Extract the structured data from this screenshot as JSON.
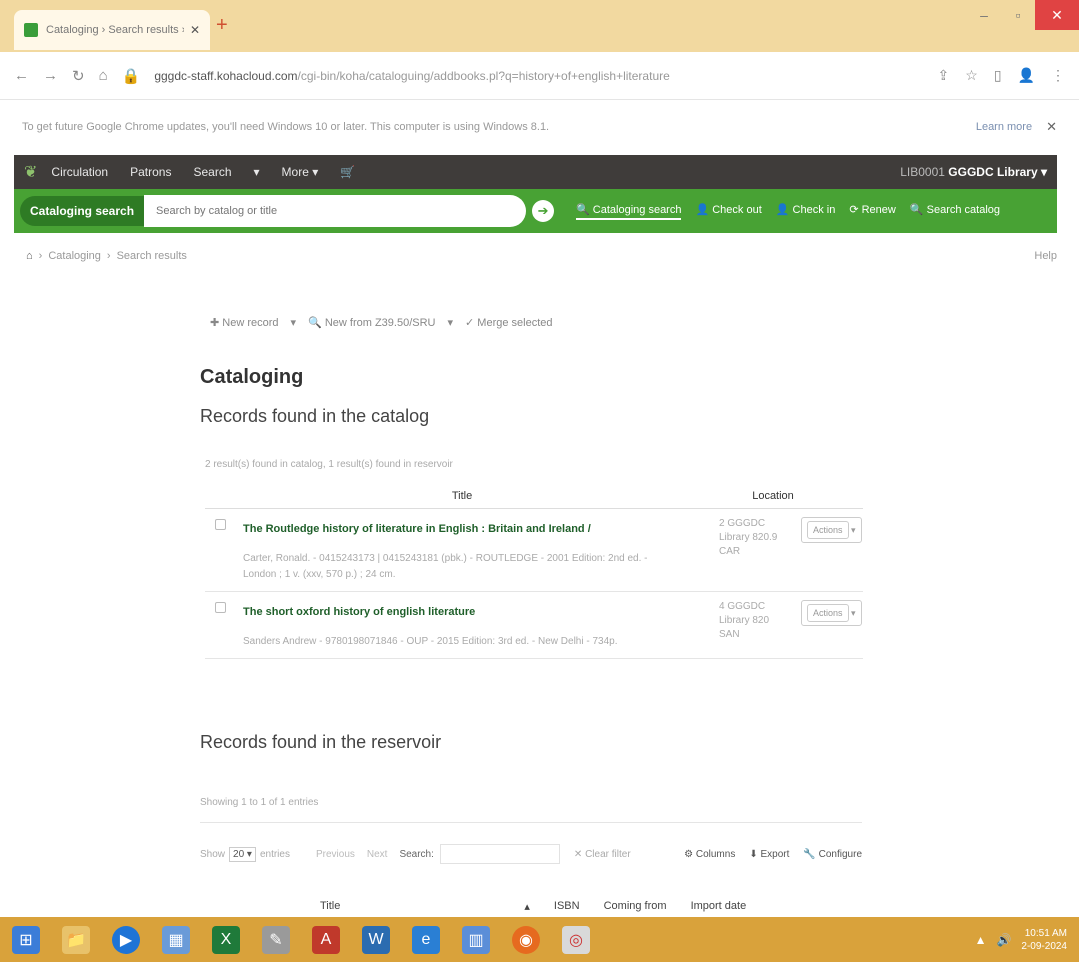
{
  "browser": {
    "tab_title": "Cataloging › Search results › Ko",
    "url_host": "gggdc-staff.kohacloud.com",
    "url_path": "/cgi-bin/koha/cataloguing/addbooks.pl?q=history+of+english+literature",
    "info_message": "To get future Google Chrome updates, you'll need Windows 10 or later. This computer is using Windows 8.1.",
    "info_link": "Learn more"
  },
  "topnav": {
    "items": [
      "Circulation",
      "Patrons",
      "Search",
      "More"
    ],
    "library": "GGGDC Library",
    "library_user": "LIB0001"
  },
  "header": {
    "search_label": "Cataloging search",
    "search_placeholder": "Search by catalog or title",
    "links": [
      "Cataloging search",
      "Check out",
      "Check in",
      "Renew",
      "Search catalog"
    ]
  },
  "breadcrumb": {
    "items": [
      "Cataloging",
      "Search results"
    ],
    "help": "Help"
  },
  "toolbar": {
    "new_record": "New record",
    "new_from_z": "New from Z39.50/SRU",
    "merge": "Merge selected"
  },
  "page": {
    "title": "Cataloging",
    "catalog_heading": "Records found in the catalog",
    "found_msg": "2 result(s) found in catalog, 1 result(s) found in reservoir",
    "reservoir_heading": "Records found in the reservoir",
    "showing": "Showing 1 to 1 of 1 entries"
  },
  "table": {
    "headers": {
      "title": "Title",
      "location": "Location"
    },
    "rows": [
      {
        "title": "The Routledge history of literature in English : Britain and Ireland /",
        "desc": "Carter, Ronald. - 0415243173 | 0415243181 (pbk.) - ROUTLEDGE - 2001 Edition: 2nd ed. - London ; 1 v. (xxv, 570 p.) ; 24 cm.",
        "location": "2 GGGDC Library 820.9 CAR",
        "action": "Actions"
      },
      {
        "title": "The short oxford history of english literature",
        "desc": "Sanders Andrew - 9780198071846 - OUP - 2015 Edition: 3rd ed. - New Delhi - 734p.",
        "location": "4 GGGDC Library 820 SAN",
        "action": "Actions"
      }
    ]
  },
  "datatable": {
    "show": "Show",
    "page_size": "20",
    "entries": "entries",
    "previous": "Previous",
    "next": "Next",
    "search": "Search:",
    "clear": "Clear filter",
    "columns": "Columns",
    "export": "Export",
    "configure": "Configure"
  },
  "reservoir_columns": [
    "Title",
    "ISBN",
    "Coming from",
    "Import date"
  ],
  "taskbar": {
    "time": "10:51 AM",
    "date": "2-09-2024"
  },
  "colors": {
    "green": "#48a234",
    "dark_nav": "#3f3c3a",
    "taskbar": "#d9a23b",
    "tab_strip": "#f2d9a0"
  }
}
